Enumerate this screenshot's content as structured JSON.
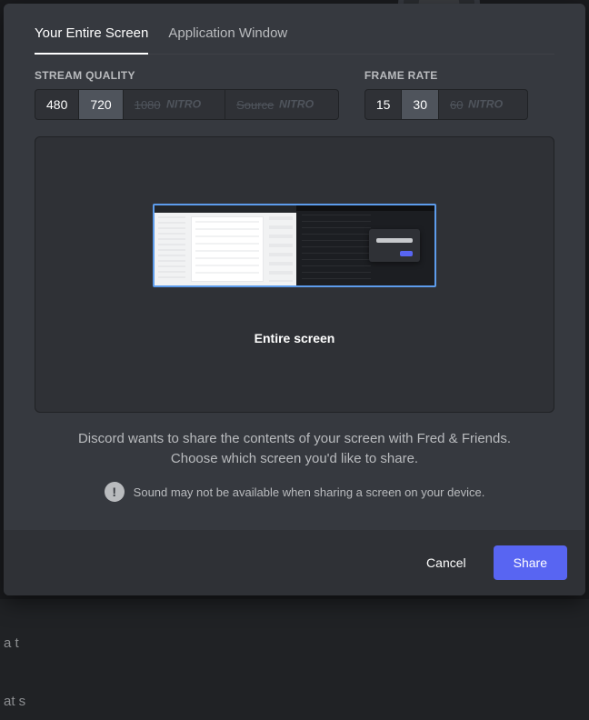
{
  "tabs": {
    "entire": "Your Entire Screen",
    "app": "Application Window",
    "active": "entire"
  },
  "quality": {
    "label": "STREAM QUALITY",
    "options": [
      "480",
      "720"
    ],
    "selected": "720",
    "locked": [
      {
        "label": "1080",
        "badge": "NITRO"
      },
      {
        "label": "Source",
        "badge": "NITRO"
      }
    ]
  },
  "framerate": {
    "label": "FRAME RATE",
    "options": [
      "15",
      "30"
    ],
    "selected": "30",
    "locked": [
      {
        "label": "60",
        "badge": "NITRO"
      }
    ]
  },
  "preview": {
    "label": "Entire screen"
  },
  "description": {
    "line1": "Discord wants to share the contents of your screen with Fred & Friends.",
    "line2": "Choose which screen you'd like to share."
  },
  "warning": "Sound may not be available when sharing a screen on your device.",
  "footer": {
    "cancel": "Cancel",
    "share": "Share"
  },
  "colors": {
    "accent": "#5865f2",
    "modal": "#36393f",
    "muted": "#b9bbbe"
  }
}
